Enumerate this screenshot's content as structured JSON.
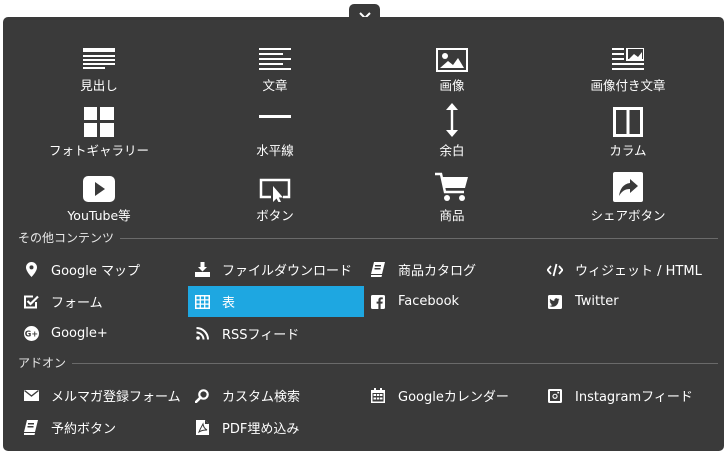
{
  "grid": [
    {
      "label": "見出し",
      "icon": "heading-icon"
    },
    {
      "label": "文章",
      "icon": "paragraph-icon"
    },
    {
      "label": "画像",
      "icon": "image-icon"
    },
    {
      "label": "画像付き文章",
      "icon": "image-text-icon"
    },
    {
      "label": "フォトギャラリー",
      "icon": "gallery-grid-icon"
    },
    {
      "label": "水平線",
      "icon": "horizontal-rule-icon"
    },
    {
      "label": "余白",
      "icon": "spacing-arrow-icon"
    },
    {
      "label": "カラム",
      "icon": "columns-icon"
    },
    {
      "label": "YouTube等",
      "icon": "video-play-icon"
    },
    {
      "label": "ボタン",
      "icon": "button-cursor-icon"
    },
    {
      "label": "商品",
      "icon": "shopping-cart-icon"
    },
    {
      "label": "シェアボタン",
      "icon": "share-arrow-icon"
    }
  ],
  "sections": {
    "other": "その他コンテンツ",
    "addon": "アドオン"
  },
  "other_items": [
    {
      "label": "Google マップ",
      "icon": "map-pin-icon"
    },
    {
      "label": "ファイルダウンロード",
      "icon": "download-icon"
    },
    {
      "label": "商品カタログ",
      "icon": "catalog-book-icon"
    },
    {
      "label": "ウィジェット / HTML",
      "icon": "code-icon"
    },
    {
      "label": "フォーム",
      "icon": "checkbox-form-icon"
    },
    {
      "label": "表",
      "icon": "table-icon",
      "active": true
    },
    {
      "label": "Facebook",
      "icon": "facebook-icon"
    },
    {
      "label": "Twitter",
      "icon": "twitter-icon"
    },
    {
      "label": "Google+",
      "icon": "google-plus-icon"
    },
    {
      "label": "RSSフィード",
      "icon": "rss-icon"
    }
  ],
  "addon_items": [
    {
      "label": "メルマガ登録フォーム",
      "icon": "envelope-icon"
    },
    {
      "label": "カスタム検索",
      "icon": "search-icon"
    },
    {
      "label": "Googleカレンダー",
      "icon": "calendar-icon"
    },
    {
      "label": "Instagramフィード",
      "icon": "instagram-icon"
    },
    {
      "label": "予約ボタン",
      "icon": "reservation-book-icon"
    },
    {
      "label": "PDF埋め込み",
      "icon": "pdf-file-icon"
    }
  ],
  "colors": {
    "panel": "#3a3a3a",
    "active": "#1ea7e1",
    "text": "#ffffff"
  }
}
